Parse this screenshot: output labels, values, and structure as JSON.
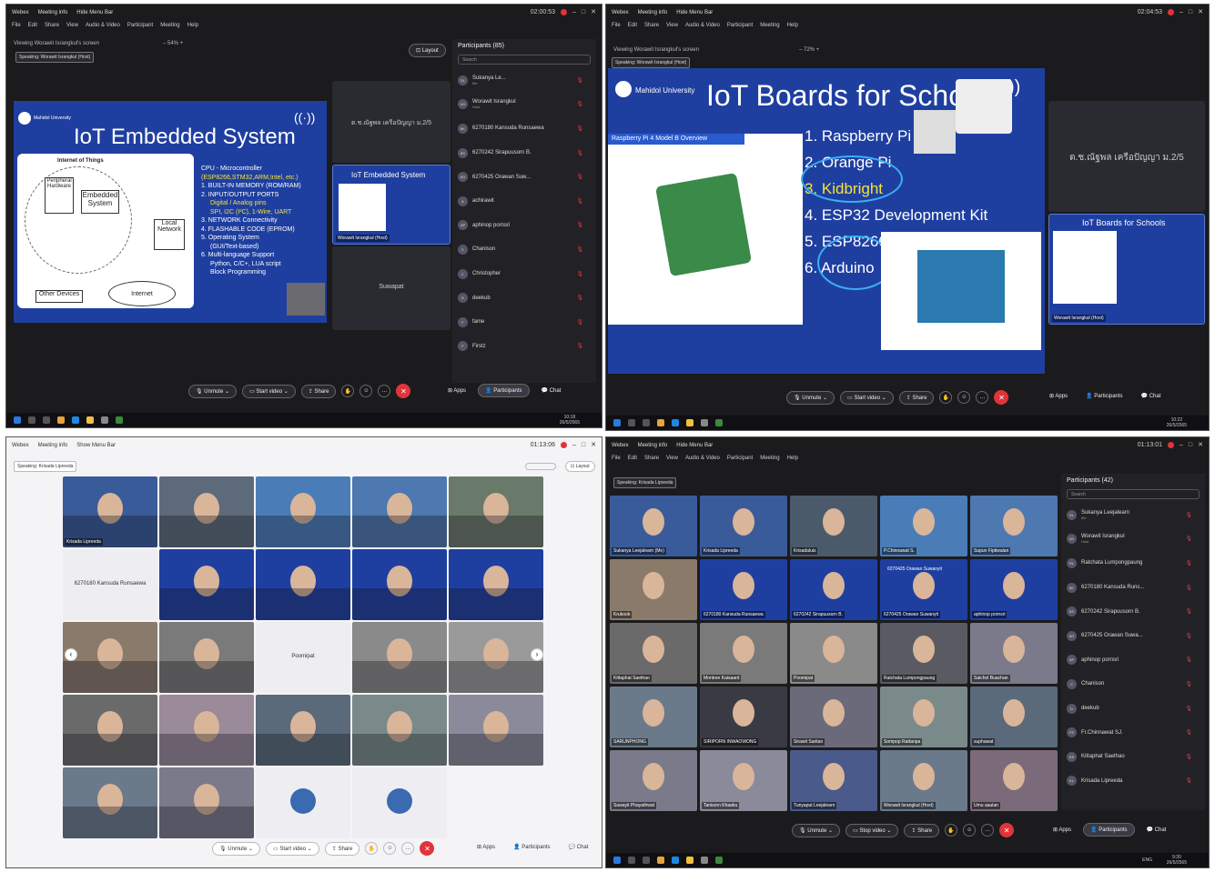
{
  "q1": {
    "app": "Webex",
    "meeting_info": "Meeting info",
    "hide_menu": "Hide Menu Bar",
    "time": "02:00:53",
    "menu": [
      "File",
      "Edit",
      "Share",
      "View",
      "Audio & Video",
      "Participant",
      "Meeting",
      "Help"
    ],
    "viewing": "Viewing Worawit Israngkul's screen",
    "zoom": "54%",
    "speaking": "Speaking: Worawit Israngkul (Host)",
    "layout": "Layout",
    "slide": {
      "university": "Mahidol University",
      "title": "IoT Embedded System",
      "diagram": {
        "iot": "Internet of Things",
        "peripheral": "Peripheral Hardware",
        "embedded": "Embedded System",
        "local": "Local Network",
        "internet": "Internet",
        "other": "Other Devices"
      },
      "cpu": "CPU - Microcontroller",
      "chips": "(ESP8266,STM32,ARM,Intel, etc.)",
      "items": [
        "1.  BUILT-IN MEMORY (ROM/RAM)",
        "2.  INPUT/OUTPUT PORTS",
        "Digital / Analog pins",
        "SPI, I2C (I²C), 1-Wire, UART",
        "3.  NETWORK Connectivity",
        "4.  FLASHABLE CODE (EPROM)",
        "5.  Operating System",
        "(GUI/Text-based)",
        "6.  Multi-language Support",
        "Python, C/C+, LUA script",
        "Block Programming"
      ]
    },
    "stage_label": "ด.ช.ณัฐพล เครือปัญญา ม.2/5",
    "thumb_title": "IoT Embedded System",
    "thumb_name": "Worawit Israngkul (Host)",
    "suwapat": "Suwapat",
    "participants_title": "Participants (85)",
    "search": "Search",
    "participants": [
      {
        "initials": "SL",
        "name": "Sukanya Le...",
        "sub": "Me"
      },
      {
        "initials": "WI",
        "name": "Worawit Israngkul",
        "sub": "Host"
      },
      {
        "initials": "6K",
        "name": "6270180 Kansuda Runsaewa",
        "sub": ""
      },
      {
        "initials": "6S",
        "name": "6270242 Sirapuusorn B.",
        "sub": ""
      },
      {
        "initials": "6O",
        "name": "6270425 Orawan Suw...",
        "sub": ""
      },
      {
        "initials": "A",
        "name": "achirawit",
        "sub": ""
      },
      {
        "initials": "AP",
        "name": "aphinop pornsri",
        "sub": ""
      },
      {
        "initials": "C",
        "name": "Chanison",
        "sub": ""
      },
      {
        "initials": "C",
        "name": "Christopher",
        "sub": ""
      },
      {
        "initials": "D",
        "name": "deekub",
        "sub": ""
      },
      {
        "initials": "F",
        "name": "fame",
        "sub": ""
      },
      {
        "initials": "F",
        "name": "Firstz",
        "sub": ""
      }
    ],
    "controls": {
      "unmute": "Unmute",
      "start_video": "Start video",
      "share": "Share",
      "apps": "Apps",
      "participants": "Participants",
      "chat": "Chat"
    },
    "clock": "10:18",
    "date": "26/5/2565"
  },
  "q2": {
    "app": "Webex",
    "meeting_info": "Meeting info",
    "hide_menu": "Hide Menu Bar",
    "time": "02:04:53",
    "menu": [
      "File",
      "Edit",
      "Share",
      "View",
      "Audio & Video",
      "Participant",
      "Meeting",
      "Help"
    ],
    "viewing": "Viewing Worawit Israngkul's screen",
    "zoom": "72%",
    "speaking": "Speaking: Worawit Israngkul (Host)",
    "slide": {
      "university": "Mahidol University",
      "title": "IoT Boards for Schools",
      "rpi_header": "Raspberry Pi 4 Model B Overview",
      "items": [
        "1.  Raspberry Pi",
        "2.  Orange Pi",
        "3.  Kidbright",
        "4.  ESP32 Development Kit",
        "5.  ESP8266",
        "6.  Arduino"
      ]
    },
    "stage_label": "ด.ช.ณัฐพล เครือปัญญา ม.2/5",
    "thumb_title": "IoT Boards for Schools",
    "thumb_name": "Worawit Israngkul (Host)",
    "controls": {
      "unmute": "Unmute",
      "start_video": "Start video",
      "share": "Share",
      "apps": "Apps",
      "participants": "Participants",
      "chat": "Chat"
    },
    "clock": "10:22",
    "date": "26/5/2565"
  },
  "q3": {
    "app": "Webex",
    "meeting_info": "Meeting info",
    "show_menu": "Show Menu Bar",
    "time": "01:13:06",
    "speaking": "Speaking: Krisada Lipreeda",
    "layout": "Layout",
    "tiles": [
      {
        "name": "Krisada Lipreeda",
        "type": "video",
        "bg": "#3a5b9a"
      },
      {
        "name": "",
        "type": "video",
        "bg": "#5d6a7a"
      },
      {
        "name": "",
        "type": "video",
        "bg": "#4a7db8"
      },
      {
        "name": "",
        "type": "video",
        "bg": "#4d78b0"
      },
      {
        "name": "",
        "type": "video",
        "bg": "#6a7a6a"
      },
      {
        "name": "6270180 Kansuda Runsaewa",
        "type": "name",
        "bg": "#eeeef2"
      },
      {
        "name": "",
        "type": "video",
        "bg": "#1f3fa0"
      },
      {
        "name": "",
        "type": "video",
        "bg": "#1f3fa0"
      },
      {
        "name": "",
        "type": "video",
        "bg": "#1f3fa0"
      },
      {
        "name": "",
        "type": "video",
        "bg": "#1f3fa0"
      },
      {
        "name": "",
        "type": "video",
        "bg": "#8a7a6a"
      },
      {
        "name": "",
        "type": "video",
        "bg": "#7a7a7a"
      },
      {
        "name": "Poomipat",
        "type": "name",
        "bg": "#eeeef2"
      },
      {
        "name": "",
        "type": "video",
        "bg": "#8a8a8a"
      },
      {
        "name": "",
        "type": "video",
        "bg": "#9a9a9a"
      },
      {
        "name": "",
        "type": "video",
        "bg": "#6a6a6a"
      },
      {
        "name": "",
        "type": "video",
        "bg": "#9a8a9a"
      },
      {
        "name": "",
        "type": "video",
        "bg": "#5a6a7a"
      },
      {
        "name": "",
        "type": "video",
        "bg": "#7a8a8a"
      },
      {
        "name": "",
        "type": "video",
        "bg": "#8a8a9a"
      },
      {
        "name": "",
        "type": "video",
        "bg": "#6a7a8a"
      },
      {
        "name": "",
        "type": "video",
        "bg": "#7a7a8a"
      },
      {
        "name": "",
        "type": "avatar",
        "bg": "#eeeef2"
      },
      {
        "name": "",
        "type": "avatar",
        "bg": "#eeeef2"
      }
    ],
    "controls": {
      "unmute": "Unmute",
      "start_video": "Start video",
      "share": "Share",
      "apps": "Apps",
      "participants": "Participants",
      "chat": "Chat"
    }
  },
  "q4": {
    "app": "Webex",
    "meeting_info": "Meeting info",
    "hide_menu": "Hide Menu Bar",
    "time": "01:13:01",
    "menu": [
      "File",
      "Edit",
      "Share",
      "View",
      "Audio & Video",
      "Participant",
      "Meeting",
      "Help"
    ],
    "speaking": "Speaking: Krisada Lipreeda",
    "participants_title": "Participants (42)",
    "search": "Search",
    "tiles": [
      {
        "name": "Sukanya Leejalearn (Me)",
        "bg": "#3a5b9a"
      },
      {
        "name": "Krisada Lipreeda",
        "bg": "#3a5b9a"
      },
      {
        "name": "Krisadaluis",
        "bg": "#4a5a6a"
      },
      {
        "name": "P.Chinnawat S.",
        "bg": "#4a7db8"
      },
      {
        "name": "Supun Fiptiwalan",
        "bg": "#4d78b0"
      },
      {
        "name": "Krukook",
        "bg": "#8a7a6a"
      },
      {
        "name": "6270180 Kansuda Runsaewa",
        "bg": "#1f3fa0"
      },
      {
        "name": "6270242 Sirapuusorn B.",
        "bg": "#1f3fa0"
      },
      {
        "name": "6270425 Orawan Suwanyit",
        "bg": "#1f3fa0"
      },
      {
        "name": "aphinop pornsri",
        "bg": "#1f3fa0"
      },
      {
        "name": "Kittaphat Saethao",
        "bg": "#6a6a6a"
      },
      {
        "name": "Montree Kaisaard",
        "bg": "#7a7a7a"
      },
      {
        "name": "Poomipat",
        "bg": "#8a8a8a"
      },
      {
        "name": "Ratchata Lumpongpaung",
        "bg": "#5a5a62"
      },
      {
        "name": "Saichol Buachan",
        "bg": "#7a7a8a"
      },
      {
        "name": "SARUNPHONG",
        "bg": "#6a7a8a"
      },
      {
        "name": "SIRIPORN INWAOWONG",
        "bg": "#3a3a44"
      },
      {
        "name": "Sirawit Saritan",
        "bg": "#6a6a7a"
      },
      {
        "name": "Sompop Rattanpa",
        "bg": "#7a8a8a"
      },
      {
        "name": "suphawat",
        "bg": "#5a6a7a"
      },
      {
        "name": "Suwayit Phayathwat",
        "bg": "#7a7a8a"
      },
      {
        "name": "Tanisorn Khaaku",
        "bg": "#8a8a9a"
      },
      {
        "name": "Tunyaput Leejalearn",
        "bg": "#4a5a8a"
      },
      {
        "name": "Worawit Israngkul (Host)",
        "bg": "#6a7a8a"
      },
      {
        "name": "Umu aaulan",
        "bg": "#7a6a7a"
      }
    ],
    "orawan_label": "6270425 Orawan Suwanyit",
    "participants": [
      {
        "initials": "SL",
        "name": "Sukanya Leejalearn",
        "sub": "Me"
      },
      {
        "initials": "WI",
        "name": "Worawit Israngkul",
        "sub": "Host"
      },
      {
        "initials": "RL",
        "name": "Ratchata Lumpongpaung",
        "sub": ""
      },
      {
        "initials": "6K",
        "name": "6270180 Kansuda Runs...",
        "sub": ""
      },
      {
        "initials": "6S",
        "name": "6270242 Sirapuusorn B.",
        "sub": ""
      },
      {
        "initials": "6O",
        "name": "6270425 Orawan Suwa...",
        "sub": ""
      },
      {
        "initials": "AP",
        "name": "aphinop pornsri",
        "sub": ""
      },
      {
        "initials": "C",
        "name": "Chanison",
        "sub": ""
      },
      {
        "initials": "D",
        "name": "deekub",
        "sub": ""
      },
      {
        "initials": "FS",
        "name": "Fr.Chinnawat SJ.",
        "sub": ""
      },
      {
        "initials": "KS",
        "name": "Kittaphat Saethao",
        "sub": ""
      },
      {
        "initials": "KL",
        "name": "Krisada Lipreeda",
        "sub": ""
      }
    ],
    "controls": {
      "unmute": "Unmute",
      "stop_video": "Stop video",
      "share": "Share",
      "apps": "Apps",
      "participants": "Participants",
      "chat": "Chat"
    },
    "lang": "ENG",
    "clock": "9:30",
    "date": "26/5/2565"
  }
}
